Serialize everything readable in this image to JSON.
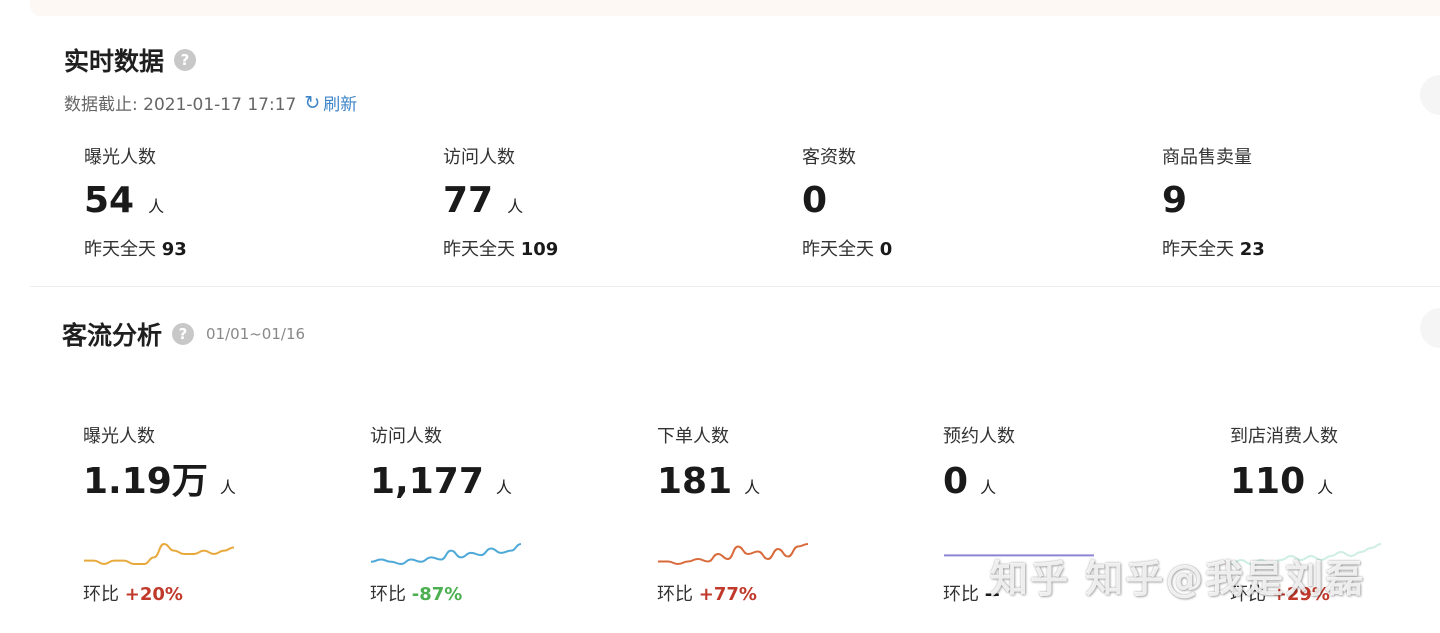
{
  "realtime": {
    "title": "实时数据",
    "help_glyph": "?",
    "cutoff_label": "数据截止: 2021-01-17 17:17",
    "refresh_label": "刷新",
    "metrics": [
      {
        "label": "曝光人数",
        "value": "54",
        "unit": "人",
        "yesterday_label": "昨天全天",
        "yesterday_value": "93"
      },
      {
        "label": "访问人数",
        "value": "77",
        "unit": "人",
        "yesterday_label": "昨天全天",
        "yesterday_value": "109"
      },
      {
        "label": "客资数",
        "value": "0",
        "unit": "",
        "yesterday_label": "昨天全天",
        "yesterday_value": "0"
      },
      {
        "label": "商品售卖量",
        "value": "9",
        "unit": "",
        "yesterday_label": "昨天全天",
        "yesterday_value": "23"
      }
    ]
  },
  "flow": {
    "title": "客流分析",
    "help_glyph": "?",
    "date_range": "01/01~01/16",
    "compare_label": "环比",
    "metrics": [
      {
        "label": "曝光人数",
        "value": "1.19万",
        "unit": "人",
        "compare": "+20%",
        "compare_color": "#c0392b",
        "spark_color": "#e8a93c",
        "spark": [
          3,
          3,
          2,
          3,
          3,
          2,
          2,
          4,
          8,
          6,
          5,
          5,
          6,
          5,
          6,
          7
        ]
      },
      {
        "label": "访问人数",
        "value": "1,177",
        "unit": "人",
        "compare": "-87%",
        "compare_color": "#4caf50",
        "spark_color": "#4ea9d8",
        "spark": [
          2,
          3,
          2,
          1,
          3,
          2,
          4,
          3,
          7,
          4,
          6,
          5,
          8,
          6,
          7,
          10
        ]
      },
      {
        "label": "下单人数",
        "value": "181",
        "unit": "人",
        "compare": "+77%",
        "compare_color": "#c0392b",
        "spark_color": "#d96a3a",
        "spark": [
          3,
          3,
          2,
          3,
          4,
          3,
          6,
          4,
          9,
          6,
          7,
          4,
          8,
          5,
          9,
          10
        ]
      },
      {
        "label": "预约人数",
        "value": "0",
        "unit": "人",
        "compare": "--",
        "compare_color": "#1a1a1a",
        "spark_color": "#8d84d6",
        "spark": [
          0,
          0,
          0,
          0,
          0,
          0,
          0,
          0,
          0,
          0,
          0,
          0,
          0,
          0,
          0,
          0
        ]
      },
      {
        "label": "到店消费人数",
        "value": "110",
        "unit": "人",
        "compare": "+29%",
        "compare_color": "#c0392b",
        "spark_color": "#cfeee4",
        "spark": [
          3,
          4,
          3,
          4,
          3,
          4,
          5,
          4,
          5,
          4,
          5,
          6,
          5,
          6,
          7,
          8
        ]
      }
    ]
  },
  "watermark": "知乎 知乎@我是刘磊",
  "colors": {
    "link": "#3f86c8",
    "increase": "#c0392b",
    "decrease": "#4caf50"
  }
}
